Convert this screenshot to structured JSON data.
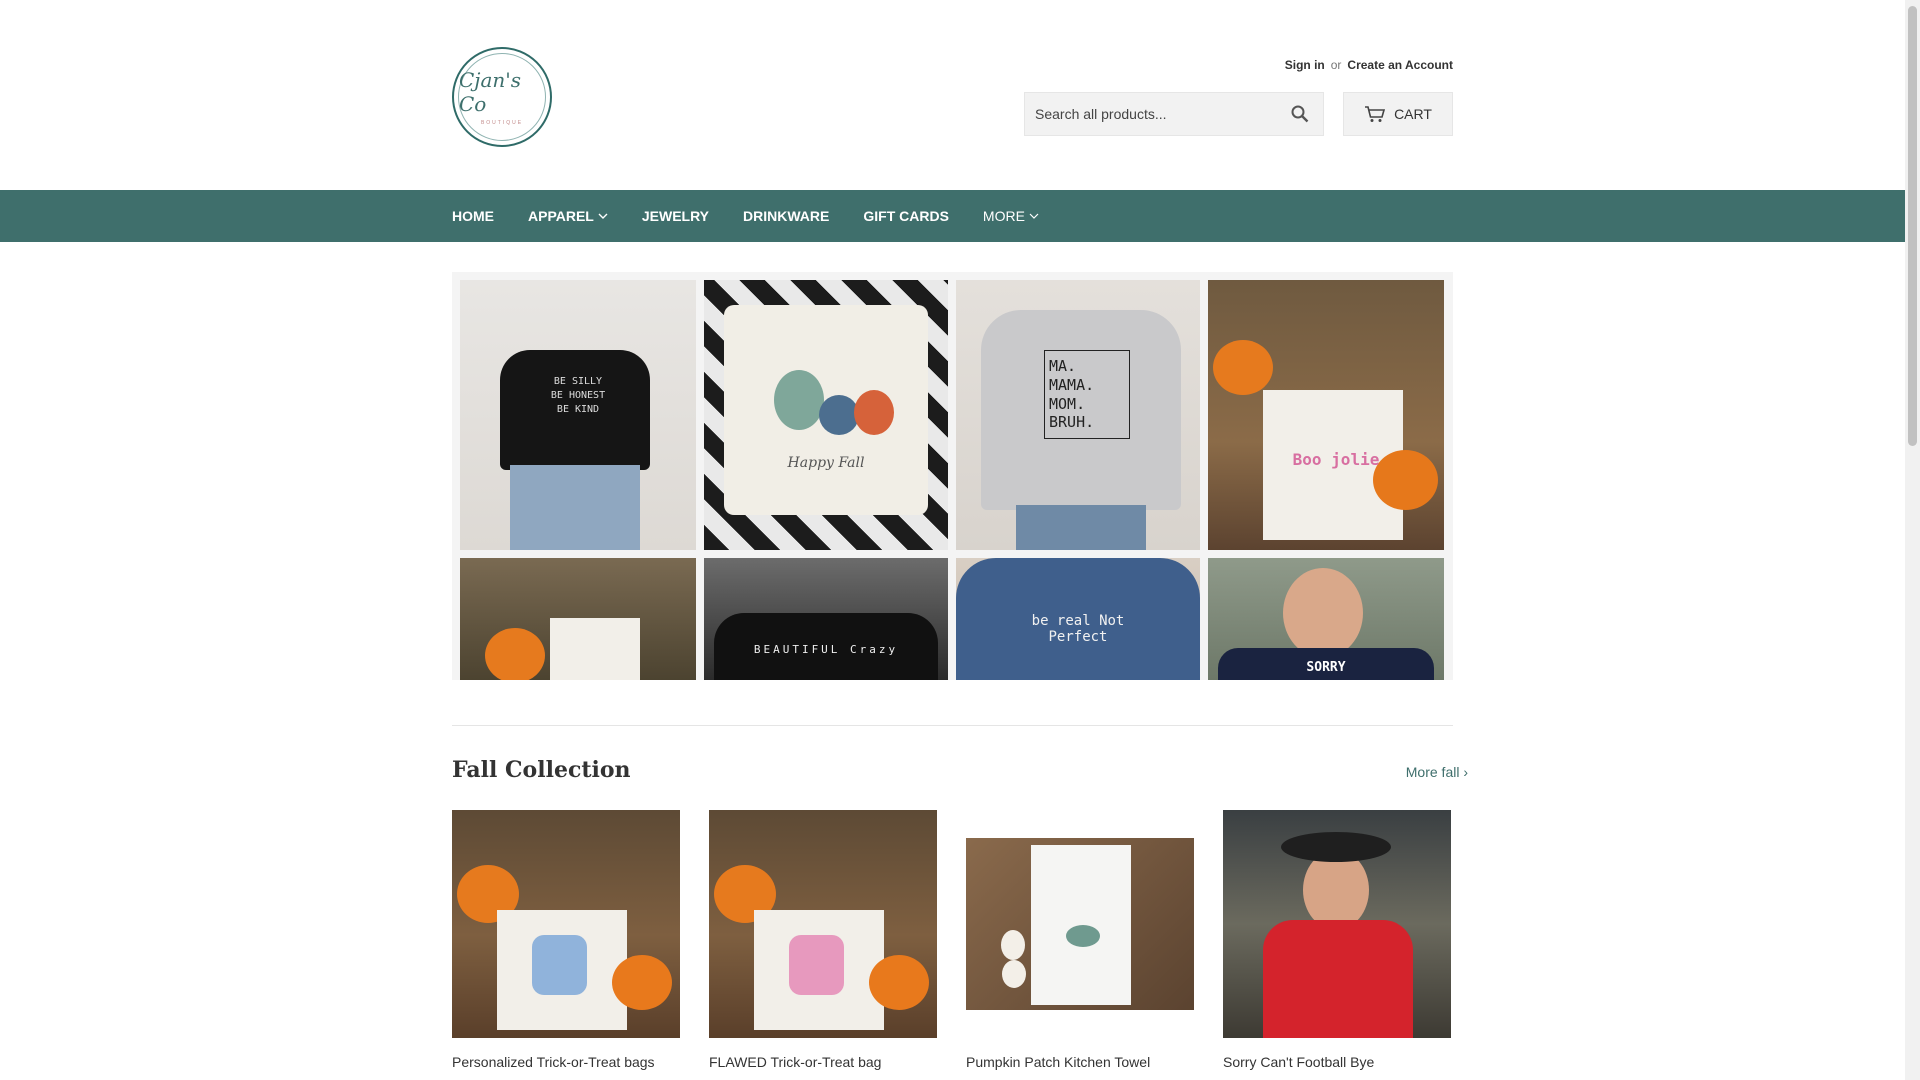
{
  "header": {
    "logo_script": "Cjan's Co",
    "logo_sub": "BOUTIQUE",
    "sign_in": "Sign in",
    "or": "or",
    "create_account": "Create an Account",
    "search_placeholder": "Search all products...",
    "cart_label": "CART"
  },
  "nav": {
    "items": [
      {
        "label": "HOME"
      },
      {
        "label": "APPAREL"
      },
      {
        "label": "JEWELRY"
      },
      {
        "label": "DRINKWARE"
      },
      {
        "label": "GIFT CARDS"
      },
      {
        "label": "MORE"
      }
    ]
  },
  "hero": {
    "tiles": [
      {
        "text": "BE SILLY BE HONEST BE KIND"
      },
      {
        "text": "Happy Fall"
      },
      {
        "text": "MA. MAMA. MOM. BRUH."
      },
      {
        "text": "Boo jolie"
      },
      {
        "text": ""
      },
      {
        "text": "BEAUTIFUL Crazy"
      },
      {
        "text": "be real Not Perfect"
      },
      {
        "text": "SORRY"
      }
    ]
  },
  "collection": {
    "title": "Fall Collection",
    "more_link": "More fall ›",
    "products": [
      {
        "title": "Personalized Trick-or-Treat bags"
      },
      {
        "title": "FLAWED Trick-or-Treat bag"
      },
      {
        "title": "Pumpkin Patch Kitchen Towel"
      },
      {
        "title": "Sorry Can't Football Bye"
      }
    ]
  },
  "colors": {
    "nav_bg": "#3f6f6c",
    "link": "#3f6f6c"
  }
}
